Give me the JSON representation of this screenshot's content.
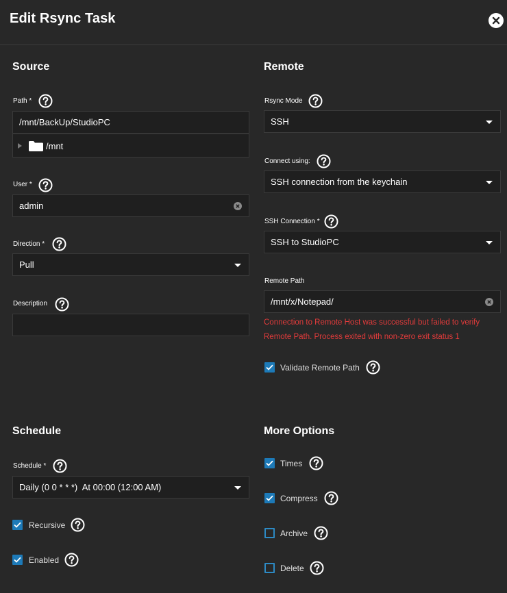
{
  "header": {
    "title": "Edit Rsync Task"
  },
  "source": {
    "title": "Source",
    "path": {
      "label": "Path *",
      "value": "/mnt/BackUp/StudioPC"
    },
    "tree": {
      "root": "/mnt"
    },
    "user": {
      "label": "User *",
      "value": "admin"
    },
    "direction": {
      "label": "Direction *",
      "value": "Pull"
    },
    "description": {
      "label": "Description",
      "value": ""
    }
  },
  "remote": {
    "title": "Remote",
    "rsync_mode": {
      "label": "Rsync Mode",
      "value": "SSH"
    },
    "connect_using": {
      "label": "Connect using:",
      "value": "SSH connection from the keychain"
    },
    "ssh_connection": {
      "label": "SSH Connection *",
      "value": "SSH to StudioPC"
    },
    "remote_path": {
      "label": "Remote Path",
      "value": "/mnt/x/Notepad/"
    },
    "error_line1": "Connection to Remote Host was successful but failed to verify",
    "error_line2": "Remote Path. Process exited with non-zero exit status 1",
    "validate": {
      "label": "Validate Remote Path",
      "checked": true
    }
  },
  "schedule": {
    "title": "Schedule",
    "schedule": {
      "label": "Schedule *",
      "value": "Daily (0 0 * * *)  At 00:00 (12:00 AM)"
    },
    "recursive": {
      "label": "Recursive",
      "checked": true
    },
    "enabled": {
      "label": "Enabled",
      "checked": true
    }
  },
  "more": {
    "title": "More Options",
    "times": {
      "label": "Times",
      "checked": true
    },
    "compress": {
      "label": "Compress",
      "checked": true
    },
    "archive": {
      "label": "Archive",
      "checked": false
    },
    "delete": {
      "label": "Delete",
      "checked": false
    }
  },
  "colors": {
    "background": "#282828",
    "input_bg": "#1f1f1f",
    "checkbox": "#1d7ab8",
    "error": "#e23b3b"
  },
  "icons": {
    "close": "close-icon",
    "help": "help-icon",
    "clear": "clear-icon",
    "dropdown": "chevron-down-icon",
    "folder": "folder-icon",
    "check": "check-icon"
  }
}
